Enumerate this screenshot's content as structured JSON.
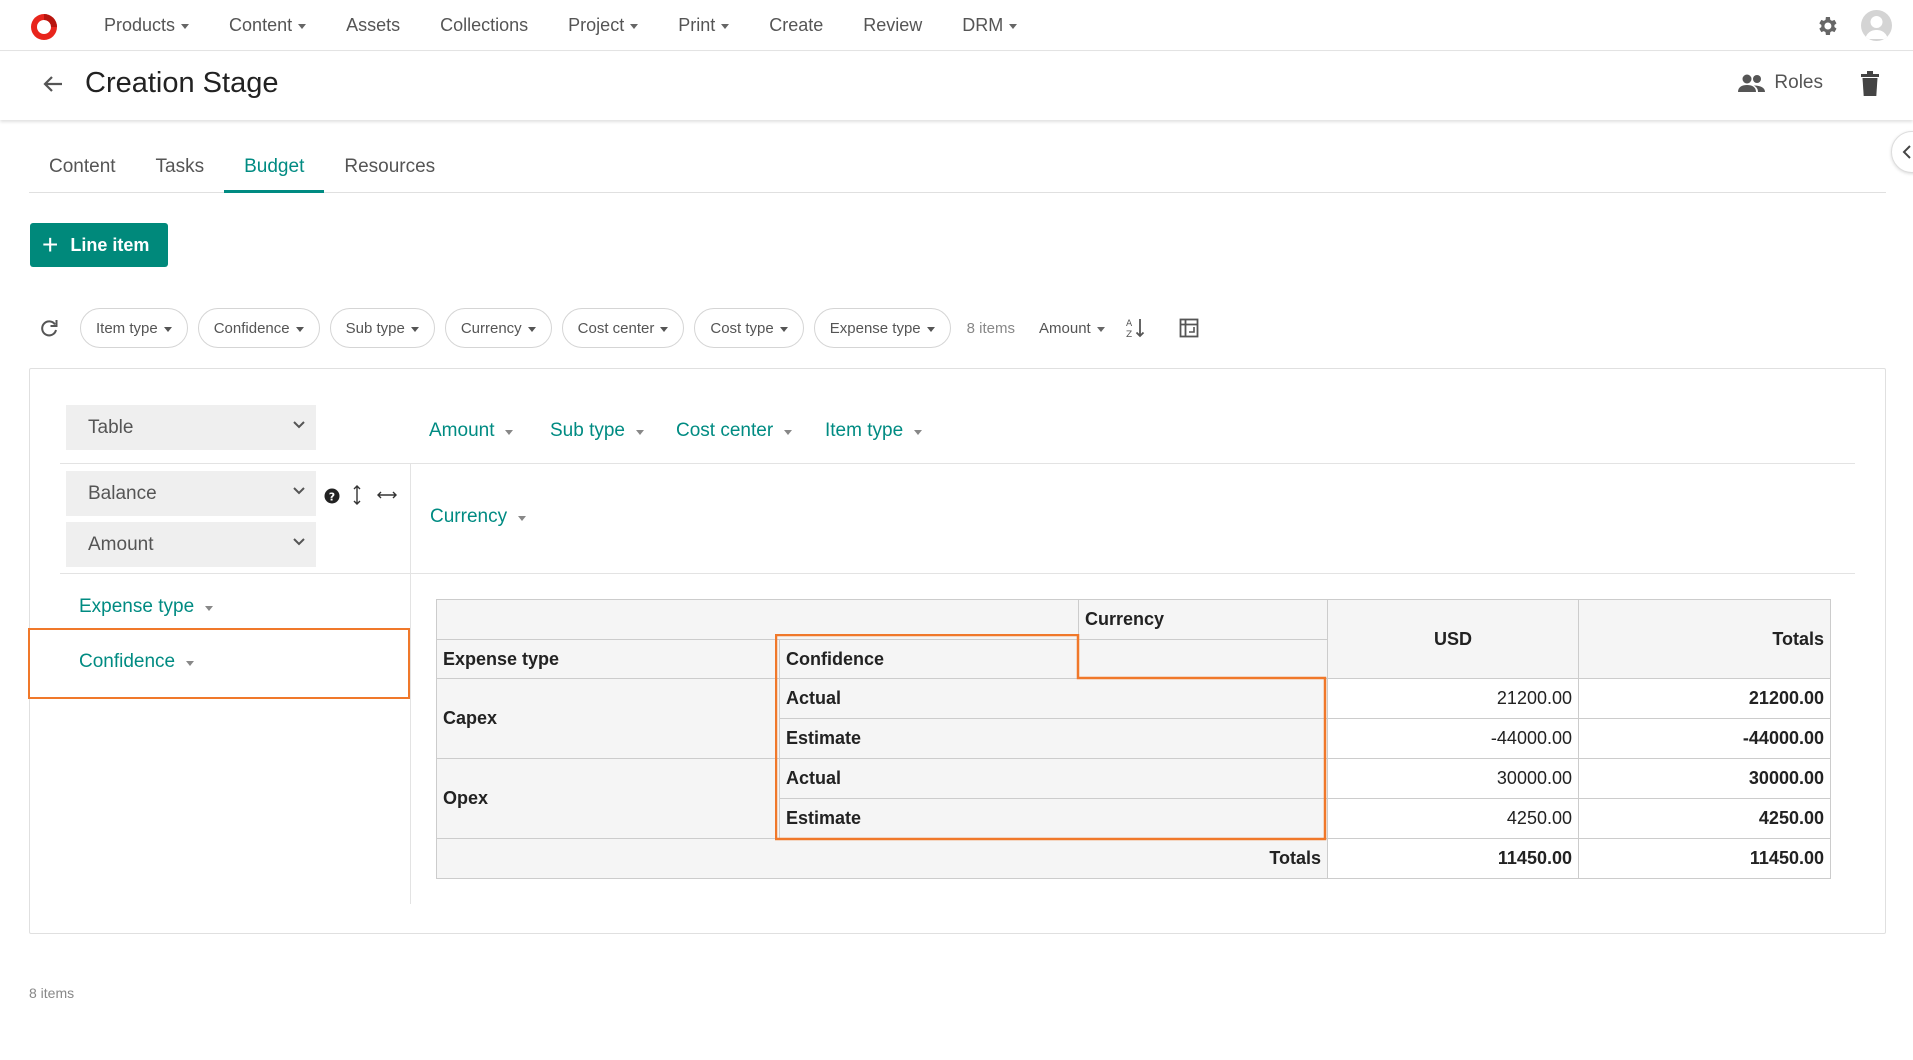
{
  "nav": {
    "items": [
      {
        "label": "Products",
        "caret": true
      },
      {
        "label": "Content",
        "caret": true
      },
      {
        "label": "Assets",
        "caret": false
      },
      {
        "label": "Collections",
        "caret": false
      },
      {
        "label": "Project",
        "caret": true
      },
      {
        "label": "Print",
        "caret": true
      },
      {
        "label": "Create",
        "caret": false
      },
      {
        "label": "Review",
        "caret": false
      },
      {
        "label": "DRM",
        "caret": true
      }
    ]
  },
  "header": {
    "title": "Creation Stage",
    "roles_label": "Roles"
  },
  "tabs": [
    {
      "label": "Content",
      "active": false
    },
    {
      "label": "Tasks",
      "active": false
    },
    {
      "label": "Budget",
      "active": true
    },
    {
      "label": "Resources",
      "active": false
    }
  ],
  "actions": {
    "add_line_item": "Line item"
  },
  "filters": {
    "chips": [
      "Item type",
      "Confidence",
      "Sub type",
      "Currency",
      "Cost center",
      "Cost type",
      "Expense type"
    ],
    "items_count": "8 items",
    "sort_label": "Amount"
  },
  "pivot": {
    "renderer_select": "Table",
    "aggregator_select": "Balance",
    "value_select": "Amount",
    "unused_fields": [
      "Amount",
      "Sub type",
      "Cost center",
      "Item type"
    ],
    "col_fields": [
      "Currency"
    ],
    "row_fields": [
      "Expense type",
      "Confidence"
    ]
  },
  "table": {
    "col_attr_header": "Currency",
    "row_attr_headers": [
      "Expense type",
      "Confidence"
    ],
    "col_values": [
      "USD"
    ],
    "totals_label": "Totals",
    "groups": [
      {
        "name": "Capex",
        "rows": [
          {
            "label": "Actual",
            "usd": "21200.00",
            "total": "21200.00"
          },
          {
            "label": "Estimate",
            "usd": "-44000.00",
            "total": "-44000.00"
          }
        ]
      },
      {
        "name": "Opex",
        "rows": [
          {
            "label": "Actual",
            "usd": "30000.00",
            "total": "30000.00"
          },
          {
            "label": "Estimate",
            "usd": "4250.00",
            "total": "4250.00"
          }
        ]
      }
    ],
    "grand_totals": {
      "usd": "11450.00",
      "total": "11450.00"
    }
  },
  "footer": {
    "items_count": "8 items"
  },
  "colors": {
    "accent": "#008b82",
    "button": "#00897b",
    "highlight": "#f0782a",
    "logo": "#e8251c"
  }
}
